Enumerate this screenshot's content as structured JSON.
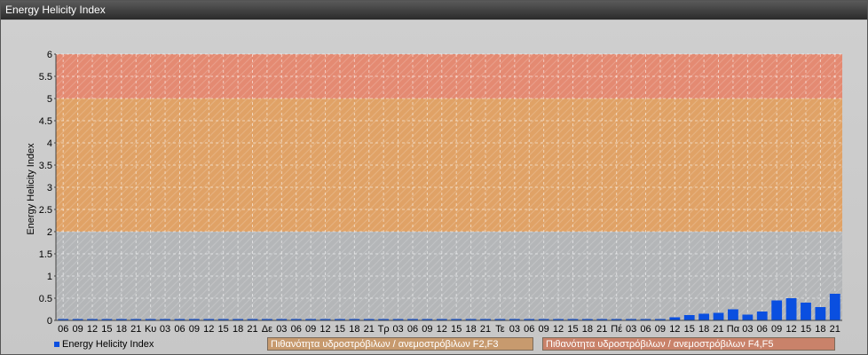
{
  "window": {
    "title": "Energy Helicity Index"
  },
  "legend": {
    "series_label": "Energy Helicity Index",
    "zone1_label": "Πιθανότητα υδροστρόβιλων / ανεμοστρόβιλων F2,F3",
    "zone2_label": "Πιθανότητα υδροστρόβιλων / ανεμοστρόβιλων F4,F5"
  },
  "colors": {
    "bar": "#0a4fe0",
    "zone_low": "#b4b6b8",
    "zone_mid": "#e0a266",
    "zone_high": "#e48a72",
    "zone1_box": "#c79a6e",
    "zone2_box": "#c9826a"
  },
  "chart_data": {
    "type": "bar",
    "title": "",
    "xlabel": "",
    "ylabel": "Energy Helicity Index",
    "ylim": [
      0,
      6
    ],
    "yticks": [
      "0",
      "0.5",
      "1",
      "1.5",
      "2",
      "2.5",
      "3",
      "3.5",
      "4",
      "4.5",
      "5",
      "5.5",
      "6"
    ],
    "zones": [
      {
        "from": 2,
        "to": 5,
        "label": "Πιθανότητα υδροστρόβιλων / ανεμοστρόβιλων F2,F3"
      },
      {
        "from": 5,
        "to": 6,
        "label": "Πιθανότητα υδροστρόβιλων / ανεμοστρόβιλων F4,F5"
      }
    ],
    "categories": [
      "06",
      "09",
      "12",
      "15",
      "18",
      "21",
      "Κυ",
      "03",
      "06",
      "09",
      "12",
      "15",
      "18",
      "21",
      "Δε",
      "03",
      "06",
      "09",
      "12",
      "15",
      "18",
      "21",
      "Τρ",
      "03",
      "06",
      "09",
      "12",
      "15",
      "18",
      "21",
      "Τε",
      "03",
      "06",
      "09",
      "12",
      "15",
      "18",
      "21",
      "Πέ",
      "03",
      "06",
      "09",
      "12",
      "15",
      "18",
      "21",
      "Πα",
      "03",
      "06",
      "09",
      "12",
      "15",
      "18",
      "21"
    ],
    "series": [
      {
        "name": "Energy Helicity Index",
        "values": [
          0.01,
          0.01,
          0.01,
          0.01,
          0.01,
          0.01,
          0.01,
          0.01,
          0.01,
          0.01,
          0.01,
          0.01,
          0.01,
          0.01,
          0.01,
          0.01,
          0.01,
          0.01,
          0.01,
          0.01,
          0.01,
          0.01,
          0.01,
          0.01,
          0.01,
          0.01,
          0.01,
          0.01,
          0.01,
          0.01,
          0.01,
          0.01,
          0.01,
          0.01,
          0.01,
          0.01,
          0.01,
          0.01,
          0.01,
          0.02,
          0.02,
          0.02,
          0.07,
          0.12,
          0.15,
          0.17,
          0.25,
          0.13,
          0.2,
          0.45,
          0.5,
          0.4,
          0.3,
          0.6
        ]
      }
    ]
  }
}
